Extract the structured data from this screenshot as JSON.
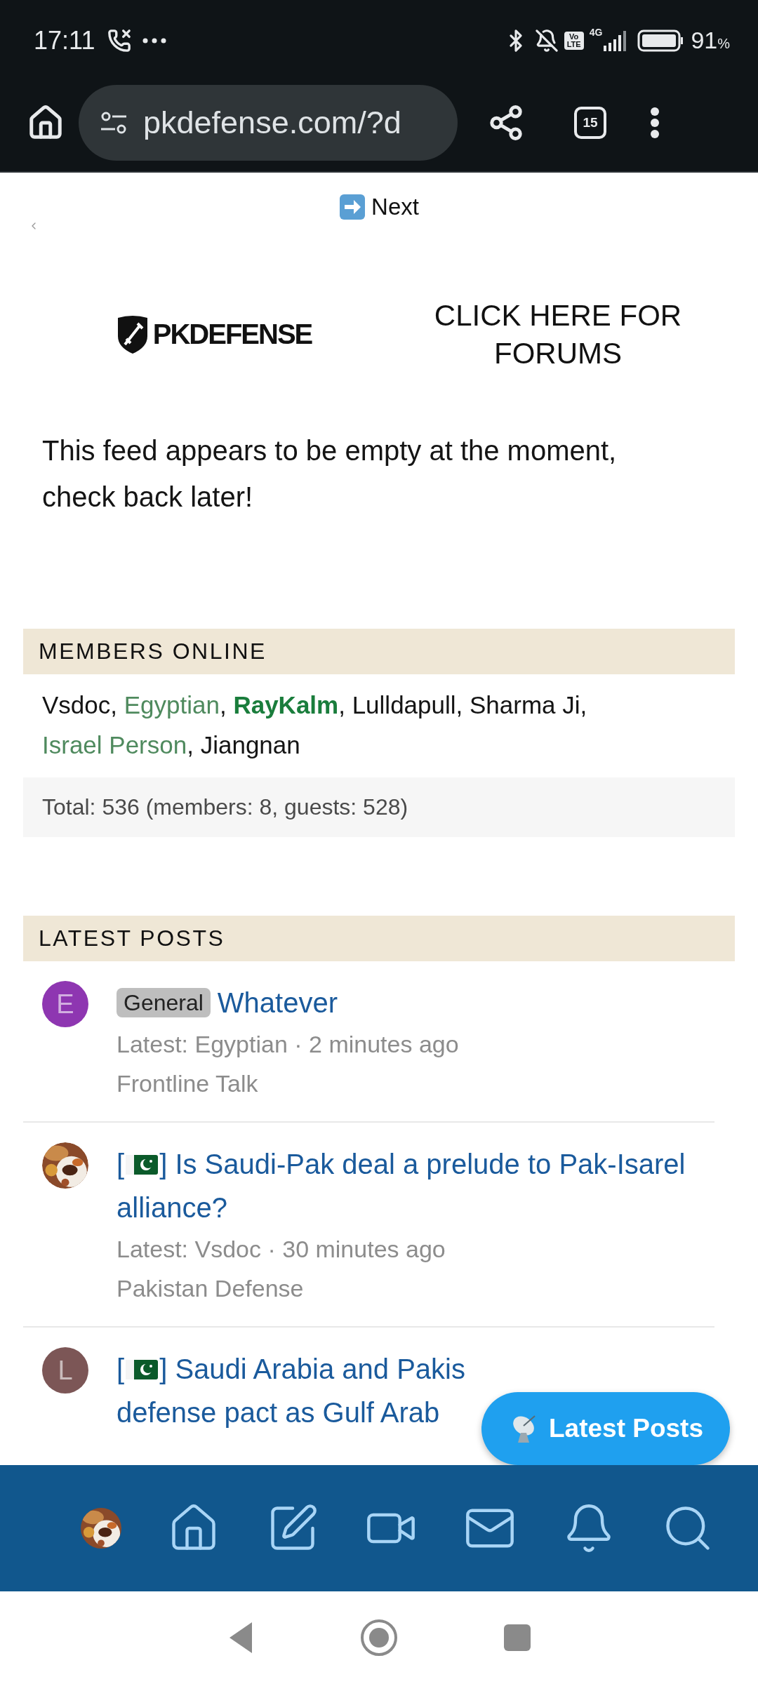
{
  "status_bar": {
    "time": "17:11",
    "volte": "Vo LTE",
    "network": "4G",
    "battery": "91",
    "battery_unit": "%"
  },
  "browser": {
    "url": "pkdefense.com/?d",
    "tab_count": "15"
  },
  "next_link": {
    "label": "Next"
  },
  "header": {
    "logo": "PKDEFENSE",
    "forums_link": "CLICK HERE FOR FORUMS"
  },
  "feed": {
    "empty_message": "This feed appears to be empty at the moment, check back later!"
  },
  "members_online": {
    "title": "MEMBERS ONLINE",
    "separator": ", ",
    "members": [
      {
        "name": "Vsdoc",
        "color": "#141414",
        "bold": false
      },
      {
        "name": "Egyptian",
        "color": "#4f8a5e",
        "bold": false
      },
      {
        "name": "RayKalm",
        "color": "#1a7d3c",
        "bold": true
      },
      {
        "name": "Lulldapull",
        "color": "#141414",
        "bold": false
      },
      {
        "name": "Sharma Ji",
        "color": "#141414",
        "bold": false
      },
      {
        "name": "Israel Person",
        "color": "#4f8a5e",
        "bold": false
      },
      {
        "name": "Jiangnan",
        "color": "#141414",
        "bold": false
      }
    ],
    "total": "Total: 536 (members: 8, guests: 528)"
  },
  "latest_posts": {
    "title": "LATEST POSTS",
    "posts": [
      {
        "avatar": {
          "kind": "letter",
          "letter": "E",
          "color": "#8e36b1"
        },
        "prefix": {
          "kind": "tag",
          "label": "General"
        },
        "title": "Whatever",
        "meta": "Latest: Egyptian · 2 minutes ago",
        "forum": "Frontline Talk"
      },
      {
        "prefix": {
          "kind": "flag",
          "open": "[",
          "close": "]"
        },
        "title": "Is Saudi-Pak deal a prelude to Pak-Isarel alliance?",
        "meta": "Latest: Vsdoc · 30 minutes ago",
        "forum": "Pakistan Defense"
      },
      {
        "avatar": {
          "kind": "letter",
          "letter": "L",
          "color": "#7c5656"
        },
        "prefix": {
          "kind": "flag",
          "open": "[",
          "close": "]"
        },
        "title": "Saudi Arabia and Pakis",
        "continuation": "defense pact as Gulf Arab"
      }
    ]
  },
  "fab": {
    "label": "Latest Posts"
  },
  "bottom_nav": {
    "items": [
      {
        "kind": "avatar"
      },
      {
        "kind": "home"
      },
      {
        "kind": "compose"
      },
      {
        "kind": "video"
      },
      {
        "kind": "mail"
      },
      {
        "kind": "bell"
      },
      {
        "kind": "search"
      }
    ]
  }
}
